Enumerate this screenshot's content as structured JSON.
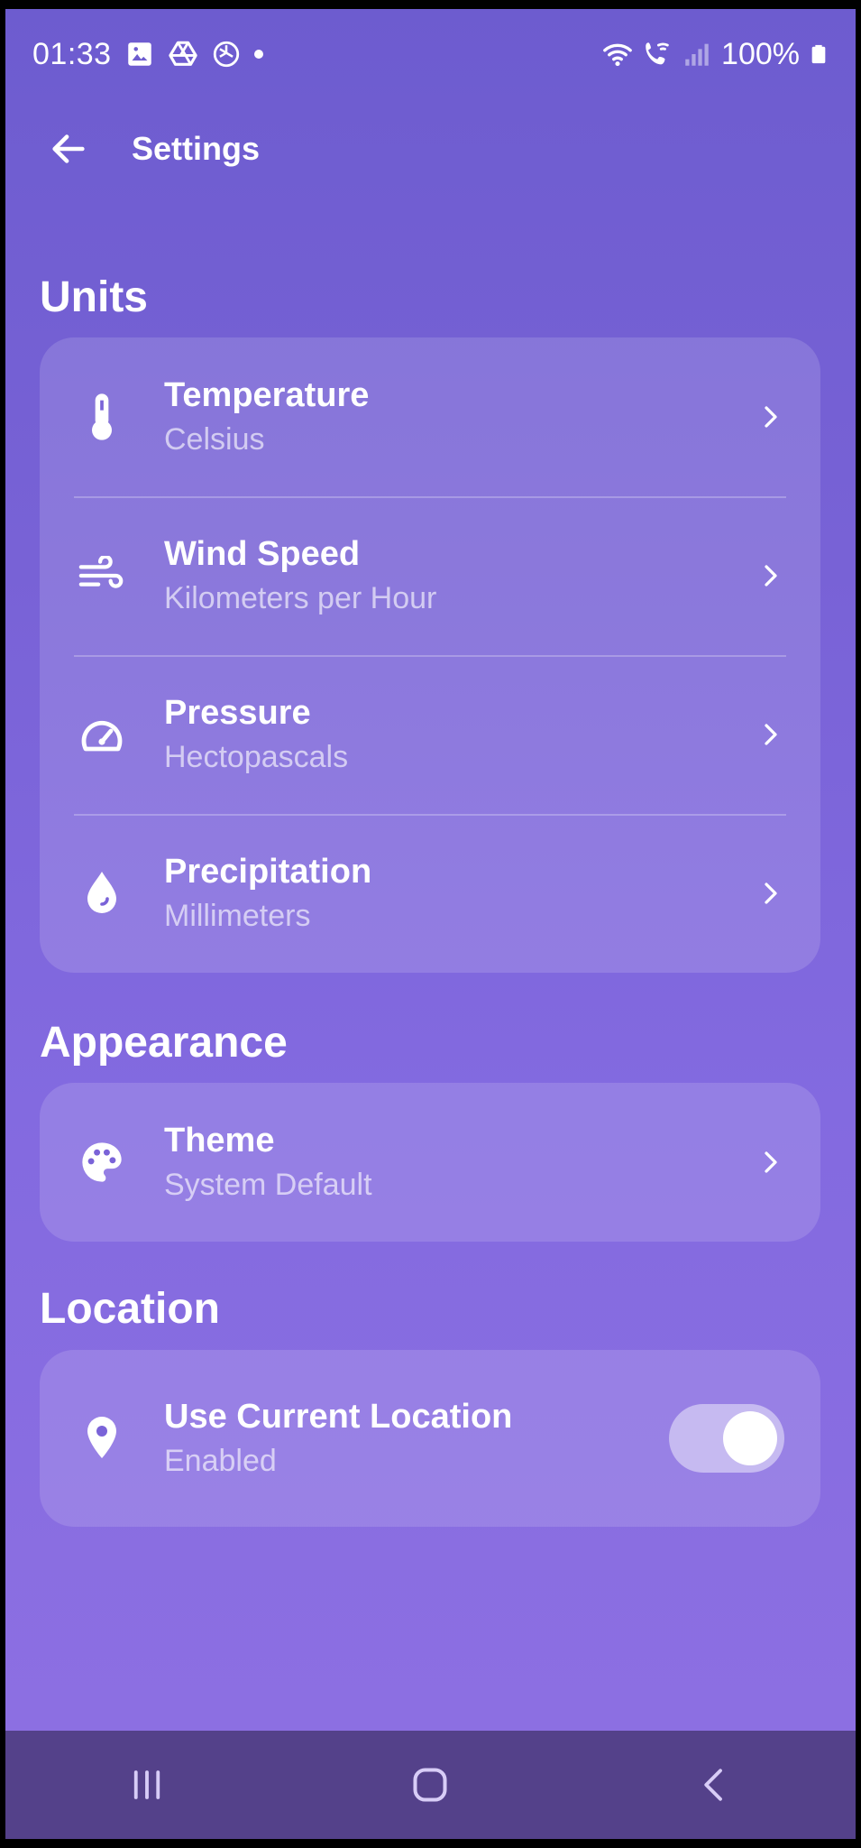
{
  "status_bar": {
    "time": "01:33",
    "battery": "100%",
    "icons": [
      "image-icon",
      "drive-icon",
      "chatgpt-icon",
      "dot-icon",
      "wifi-icon",
      "wifi-call-icon",
      "signal-icon",
      "battery-icon"
    ]
  },
  "app_bar": {
    "title": "Settings",
    "back_icon": "arrow-left-icon"
  },
  "sections": {
    "units": {
      "title": "Units",
      "items": [
        {
          "title": "Temperature",
          "value": "Celsius",
          "icon": "thermometer-icon"
        },
        {
          "title": "Wind Speed",
          "value": "Kilometers per Hour",
          "icon": "wind-icon"
        },
        {
          "title": "Pressure",
          "value": "Hectopascals",
          "icon": "gauge-icon"
        },
        {
          "title": "Precipitation",
          "value": "Millimeters",
          "icon": "water-drop-icon"
        }
      ]
    },
    "appearance": {
      "title": "Appearance",
      "items": [
        {
          "title": "Theme",
          "value": "System Default",
          "icon": "palette-icon"
        }
      ]
    },
    "location": {
      "title": "Location",
      "items": [
        {
          "title": "Use Current Location",
          "value": "Enabled",
          "icon": "location-pin-icon",
          "toggle_on": true
        }
      ]
    }
  },
  "nav_bar": {
    "buttons": [
      "recents-icon",
      "home-icon",
      "back-icon"
    ]
  },
  "colors": {
    "background_top": "#6d5ccf",
    "background_bottom": "#8e70e2",
    "nav_bar": "#54418a"
  }
}
